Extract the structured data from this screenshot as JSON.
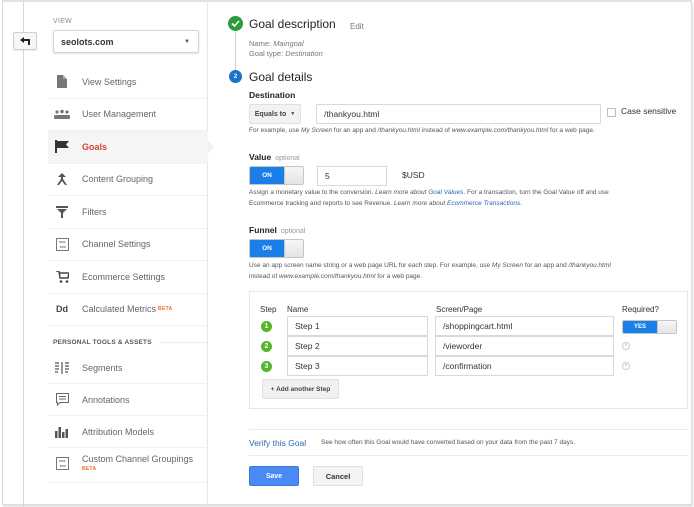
{
  "sidebar": {
    "back_icon": "back-arrow-icon",
    "view_label": "VIEW",
    "view_selected": "seolots.com",
    "items": [
      {
        "label": "View Settings",
        "icon": "document-icon"
      },
      {
        "label": "User Management",
        "icon": "users-icon"
      },
      {
        "label": "Goals",
        "icon": "flag-icon",
        "active": true
      },
      {
        "label": "Content Grouping",
        "icon": "content-grouping-icon"
      },
      {
        "label": "Filters",
        "icon": "filter-icon"
      },
      {
        "label": "Channel Settings",
        "icon": "channel-settings-icon"
      },
      {
        "label": "Ecommerce Settings",
        "icon": "cart-icon"
      },
      {
        "label": "Calculated Metrics",
        "icon": "calculated-metrics-icon",
        "badge": "BETA"
      }
    ],
    "section_header": "PERSONAL TOOLS & ASSETS",
    "personal_items": [
      {
        "label": "Segments",
        "icon": "segments-icon"
      },
      {
        "label": "Annotations",
        "icon": "annotation-icon"
      },
      {
        "label": "Attribution Models",
        "icon": "bar-chart-icon"
      },
      {
        "label": "Custom Channel Groupings",
        "icon": "channel-grouping-icon",
        "badge": "BETA"
      }
    ],
    "icon_text_dd": "Dd"
  },
  "goal_description": {
    "title": "Goal description",
    "edit_label": "Edit",
    "name_label": "Name:",
    "name_value": "Maingoal",
    "type_label": "Goal type:",
    "type_value": "Destination"
  },
  "goal_details": {
    "step_number": "2",
    "title": "Goal details",
    "destination": {
      "label": "Destination",
      "match_type": "Equals to",
      "value": "/thankyou.html",
      "case_sensitive_label": "Case sensitive",
      "case_sensitive": false,
      "hint_parts": [
        "For example, use ",
        "My Screen",
        " for an app and ",
        "/thankyou.html",
        " instead of ",
        "www.example.com/thankyou.html",
        " for a web page."
      ]
    },
    "value": {
      "label": "Value",
      "optional": "optional",
      "toggle": "ON",
      "amount": "5",
      "currency": "$USD",
      "hint_line1_parts": [
        "Assign a monetary value to the conversion. ",
        "Learn more about ",
        "Goal Values",
        ". For a transaction, turn the Goal Value off and use"
      ],
      "hint_line2_parts": [
        "Ecommerce tracking and reports to see Revenue. ",
        "Learn more about ",
        "Ecommerce Transactions",
        "."
      ]
    },
    "funnel": {
      "label": "Funnel",
      "optional": "optional",
      "toggle": "ON",
      "hint_line1_parts": [
        "Use an app screen name string or a web page URL for each step. For example, use ",
        "My Screen",
        " for an app and ",
        "/thankyou.html"
      ],
      "hint_line2_parts": [
        "instead of ",
        "www.example.com/thankyou.html",
        " for a web page."
      ],
      "headers": {
        "step": "Step",
        "name": "Name",
        "page": "Screen/Page",
        "required": "Required?"
      },
      "steps": [
        {
          "num": "1",
          "name": "Step 1",
          "page": "/shoppingcart.html",
          "required": "YES"
        },
        {
          "num": "2",
          "name": "Step 2",
          "page": "/vieworder"
        },
        {
          "num": "3",
          "name": "Step 3",
          "page": "/confirmation"
        }
      ],
      "add_step_label": "+ Add another Step"
    }
  },
  "verify": {
    "link": "Verify this Goal",
    "text": "See how often this Goal would have converted based on your data from the past 7 days."
  },
  "actions": {
    "save": "Save",
    "cancel": "Cancel"
  },
  "colors": {
    "active_nav": "#d3462d",
    "toggle_on": "#1a7fe8",
    "save": "#4a8af4",
    "step_badge": "#57b52a",
    "check": "#2e9b3a",
    "link": "#2a66b2"
  }
}
